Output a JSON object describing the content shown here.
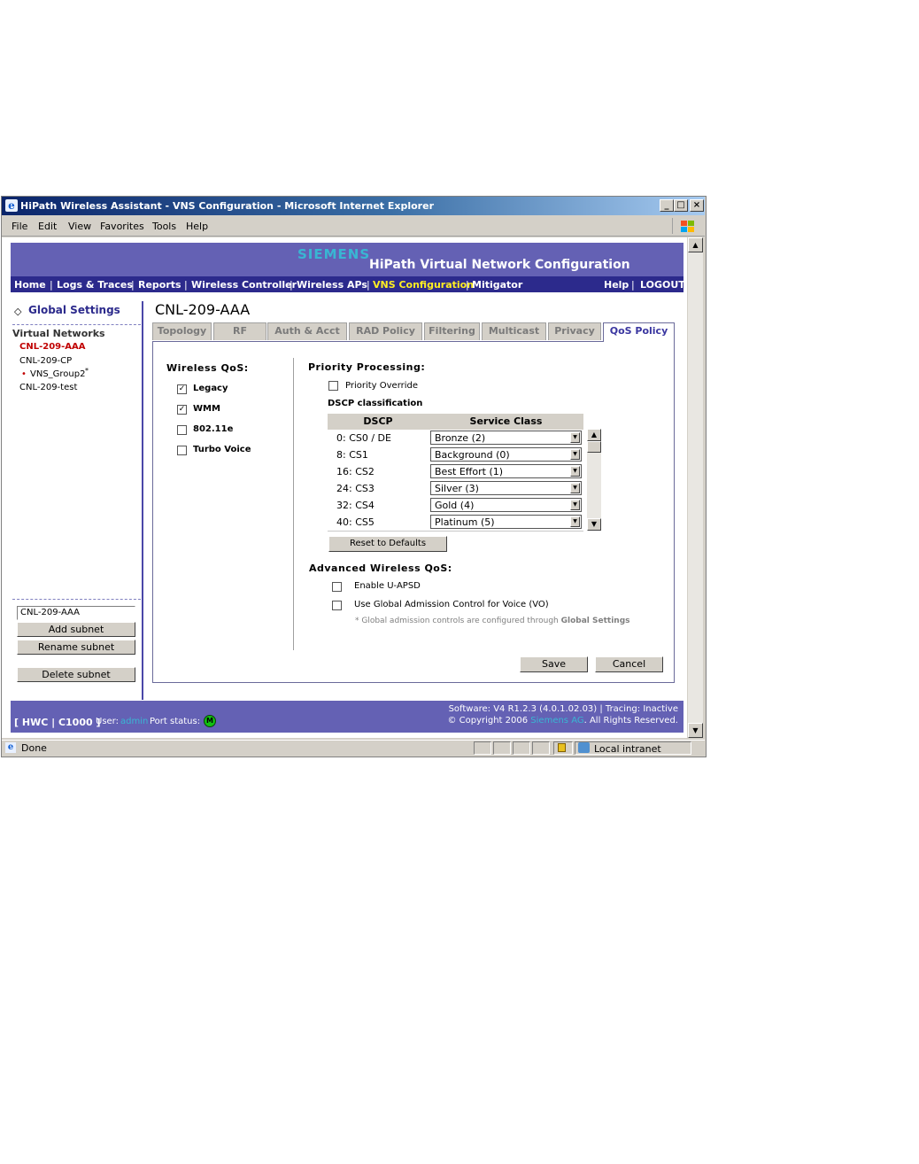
{
  "window": {
    "title": "HiPath Wireless Assistant - VNS Configuration - Microsoft Internet Explorer",
    "controls": {
      "minimize": "_",
      "maximize": "□",
      "close": "×"
    }
  },
  "menubar": {
    "items": [
      "File",
      "Edit",
      "View",
      "Favorites",
      "Tools",
      "Help"
    ]
  },
  "banner": {
    "brand": "SIEMENS",
    "title": "HiPath Virtual Network Configuration"
  },
  "nav": {
    "items": [
      "Home",
      "Logs & Traces",
      "Reports",
      "Wireless Controller",
      "Wireless APs",
      "VNS Configuration",
      "Mitigator"
    ],
    "active": "VNS Configuration",
    "right": [
      "Help",
      "LOGOUT"
    ],
    "separator": "|"
  },
  "sidebar": {
    "global_settings": "Global Settings",
    "global_icon": "◇",
    "section_title": "Virtual Networks",
    "networks": [
      "CNL-209-AAA",
      "CNL-209-CP",
      "VNS_Group2",
      "CNL-209-test"
    ],
    "group_marker": "•",
    "group_suffix": "*",
    "subnet_name_value": "CNL-209-AAA",
    "add_subnet": "Add subnet",
    "rename_subnet": "Rename subnet",
    "delete_subnet": "Delete subnet"
  },
  "main": {
    "title": "CNL-209-AAA",
    "tabs": [
      "Topology",
      "RF",
      "Auth & Acct",
      "RAD Policy",
      "Filtering",
      "Multicast",
      "Privacy",
      "QoS Policy"
    ],
    "active_tab": "QoS Policy",
    "wireless_qos": {
      "label": "Wireless QoS:",
      "options": [
        {
          "label": "Legacy",
          "checked": true
        },
        {
          "label": "WMM",
          "checked": true
        },
        {
          "label": "802.11e",
          "checked": false
        },
        {
          "label": "Turbo Voice",
          "checked": false
        }
      ]
    },
    "priority_processing": {
      "label": "Priority Processing:",
      "override_label": "Priority Override",
      "override_checked": false,
      "dscp_label": "DSCP classification",
      "columns": [
        "DSCP",
        "Service Class"
      ],
      "rows": [
        {
          "dscp": "0: CS0 / DE",
          "service": "Bronze (2)"
        },
        {
          "dscp": "8: CS1",
          "service": "Background (0)"
        },
        {
          "dscp": "16: CS2",
          "service": "Best Effort (1)"
        },
        {
          "dscp": "24: CS3",
          "service": "Silver (3)"
        },
        {
          "dscp": "32: CS4",
          "service": "Gold (4)"
        },
        {
          "dscp": "40: CS5",
          "service": "Platinum (5)"
        }
      ],
      "reset_label": "Reset to Defaults"
    },
    "advanced": {
      "label": "Advanced Wireless QoS:",
      "enable_uapsd": "Enable U-APSD",
      "enable_uapsd_checked": false,
      "global_admission": "Use Global Admission Control for Voice (VO)",
      "global_admission_checked": false,
      "note_prefix": "* Global admission controls are configured through",
      "note_link": "Global Settings"
    },
    "save_label": "Save",
    "cancel_label": "Cancel"
  },
  "footer": {
    "system": "[ HWC | C1000 ]",
    "user_label": "User:",
    "user": "admin",
    "port_status_label": "Port status:",
    "port_status_icon": "M",
    "software": "Software: V4 R1.2.3 (4.0.1.02.03) | Tracing: Inactive",
    "copyright_prefix": "© Copyright  2006",
    "company": "Siemens AG",
    "copyright_suffix": ". All Rights Reserved."
  },
  "statusbar": {
    "status": "Done",
    "zone": "Local intranet"
  },
  "colors": {
    "banner": "#6461b4",
    "nav": "#2c2a8c",
    "active_nav": "#ffee22",
    "siemens": "#39b6d3",
    "selected_network": "#c00000"
  }
}
